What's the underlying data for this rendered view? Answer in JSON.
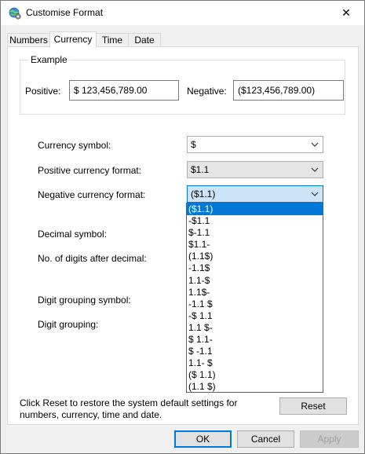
{
  "window": {
    "title": "Customise Format",
    "close_glyph": "✕"
  },
  "tabs": [
    {
      "label": "Numbers"
    },
    {
      "label": "Currency"
    },
    {
      "label": "Time"
    },
    {
      "label": "Date"
    }
  ],
  "example": {
    "legend": "Example",
    "positive_label": "Positive:",
    "positive_value": "$ 123,456,789.00",
    "negative_label": "Negative:",
    "negative_value": "($123,456,789.00)"
  },
  "fields": {
    "currency_symbol_label": "Currency symbol:",
    "currency_symbol_value": "$",
    "positive_format_label": "Positive currency format:",
    "positive_format_value": "$1.1",
    "negative_format_label": "Negative currency format:",
    "negative_format_value": "($1.1)",
    "decimal_symbol_label": "Decimal symbol:",
    "digits_after_decimal_label": "No. of digits after decimal:",
    "grouping_symbol_label": "Digit grouping symbol:",
    "digit_grouping_label": "Digit grouping:"
  },
  "negative_format_options": [
    "($1.1)",
    "-$1.1",
    "$-1.1",
    "$1.1-",
    "(1.1$)",
    "-1.1$",
    "1.1-$",
    "1.1$-",
    "-1.1 $",
    "-$ 1.1",
    "1.1 $-",
    "$ 1.1-",
    "$ -1.1",
    "1.1- $",
    "($ 1.1)",
    "(1.1 $)"
  ],
  "selected_option_index": 0,
  "reset_info": "Click Reset to restore the system default settings for numbers, currency, time and date.",
  "buttons": {
    "reset": "Reset",
    "ok": "OK",
    "cancel": "Cancel",
    "apply": "Apply"
  },
  "colors": {
    "accent": "#0078d7",
    "dialog_bg": "#f0f0f0",
    "panel_bg": "#ffffff"
  }
}
